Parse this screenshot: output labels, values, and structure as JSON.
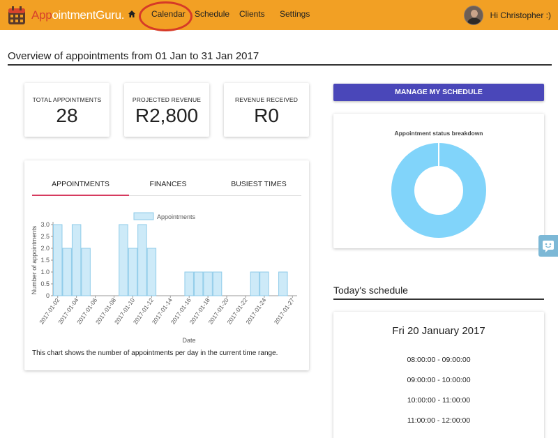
{
  "app": {
    "name_part1": "App",
    "name_part2": "ointmentGuru."
  },
  "nav": {
    "home_icon": "home-icon",
    "items": [
      {
        "label": "Calendar"
      },
      {
        "label": "Schedule"
      },
      {
        "label": "Clients"
      },
      {
        "label": "Settings"
      }
    ]
  },
  "user": {
    "greeting": "Hi Christopher :)"
  },
  "overview": {
    "title": "Overview of appointments from 01 Jan to 31 Jan 2017"
  },
  "stats": [
    {
      "label": "TOTAL APPOINTMENTS",
      "value": "28"
    },
    {
      "label": "PROJECTED REVENUE",
      "value": "R2,800"
    },
    {
      "label": "REVENUE RECEIVED",
      "value": "R0"
    }
  ],
  "manage_button": "MANAGE MY SCHEDULE",
  "tabs": [
    {
      "label": "APPOINTMENTS",
      "active": true
    },
    {
      "label": "FINANCES",
      "active": false
    },
    {
      "label": "BUSIEST TIMES",
      "active": false
    }
  ],
  "chart_caption": "This chart shows the number of appointments per day in the current time range.",
  "chart_data": [
    {
      "type": "bar",
      "legend": "Appointments",
      "ylabel": "Number of appointments",
      "xlabel": "Date",
      "ylim": [
        0,
        3.0
      ],
      "yticks": [
        "0",
        "0.5",
        "1.0",
        "1.5",
        "2.0",
        "2.5",
        "3.0"
      ],
      "categories": [
        "2017-01-02",
        "2017-01-03",
        "2017-01-04",
        "2017-01-05",
        "2017-01-06",
        "2017-01-07",
        "2017-01-08",
        "2017-01-09",
        "2017-01-10",
        "2017-01-11",
        "2017-01-12",
        "2017-01-13",
        "2017-01-14",
        "2017-01-15",
        "2017-01-16",
        "2017-01-17",
        "2017-01-18",
        "2017-01-19",
        "2017-01-20",
        "2017-01-21",
        "2017-01-22",
        "2017-01-23",
        "2017-01-24",
        "2017-01-25",
        "2017-01-26",
        "2017-01-27"
      ],
      "xtick_labels": [
        "2017-01-02",
        "2017-01-04",
        "2017-01-06",
        "2017-01-08",
        "2017-01-10",
        "2017-01-12",
        "2017-01-14",
        "2017-01-16",
        "2017-01-18",
        "2017-01-20",
        "2017-01-22",
        "2017-01-24",
        "2017-01-27"
      ],
      "values": [
        3,
        2,
        3,
        2,
        0,
        0,
        0,
        3,
        2,
        3,
        2,
        0,
        0,
        0,
        1,
        1,
        1,
        1,
        0,
        0,
        0,
        1,
        1,
        0,
        1,
        0
      ],
      "colors": {
        "fill": "#cdeaf8",
        "stroke": "#8ecbe9"
      }
    },
    {
      "type": "pie",
      "title": "Appointment status breakdown",
      "slices": [
        {
          "value": 28,
          "color": "#81d4fa"
        }
      ]
    }
  ],
  "today": {
    "title": "Today's schedule",
    "date": "Fri 20 January 2017",
    "slots": [
      "08:00:00 - 09:00:00",
      "09:00:00 - 10:00:00",
      "10:00:00 - 11:00:00",
      "11:00:00 - 12:00:00"
    ]
  },
  "colors": {
    "topbar": "#f2a024",
    "brand_red": "#d8432b",
    "button": "#4a47b9",
    "tab_active": "#d63a5f"
  },
  "chat_icon": "chat-icon"
}
